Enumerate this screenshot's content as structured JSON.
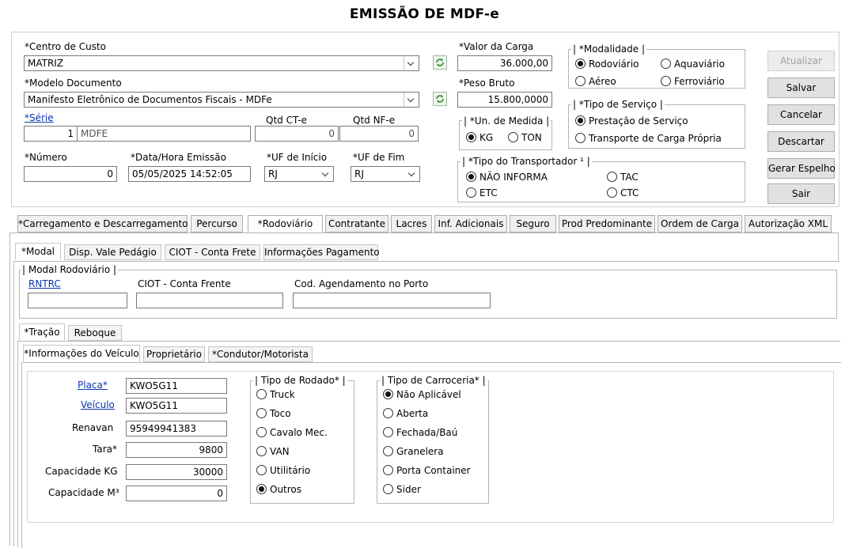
{
  "window_title": "EMISSÃO DE MDF-e",
  "header": {
    "centro_custo_label": "*Centro de Custo",
    "centro_custo_value": "MATRIZ",
    "modelo_label": "*Modelo Documento",
    "modelo_value": "Manifesto Eletrônico de Documentos Fiscais - MDFe",
    "serie_label": "*Série",
    "serie_num": "1",
    "serie_desc": "MDFE",
    "qtd_cte_label": "Qtd CT-e",
    "qtd_cte_value": "0",
    "qtd_nfe_label": "Qtd NF-e",
    "qtd_nfe_value": "0",
    "numero_label": "*Número",
    "numero_value": "0",
    "data_label": "*Data/Hora Emissão",
    "data_value": "05/05/2025 14:52:05",
    "uf_inicio_label": "*UF de Início",
    "uf_inicio_value": "RJ",
    "uf_fim_label": "*UF de Fim",
    "uf_fim_value": "RJ",
    "valor_carga_label": "*Valor da Carga",
    "valor_carga_value": "36.000,00",
    "peso_bruto_label": "*Peso Bruto",
    "peso_bruto_value": "15.800,0000",
    "un_medida_label": "*Un. de Medida",
    "un_kg": "KG",
    "un_ton": "TON",
    "modalidade_label": "*Modalidade",
    "mod_rodoviario": "Rodoviário",
    "mod_aquaviario": "Aquaviário",
    "mod_aereo": "Aéreo",
    "mod_ferroviario": "Ferroviário",
    "tipo_servico_label": "*Tipo de Serviço",
    "serv_prestacao": "Prestação de Serviço",
    "serv_propria": "Transporte de Carga Própria",
    "tipo_transp_label": "*Tipo do Transportador ¹",
    "transp_nao_informa": "NÃO INFORMA",
    "transp_tac": "TAC",
    "transp_etc": "ETC",
    "transp_ctc": "CTC"
  },
  "buttons": {
    "atualizar": "Atualizar",
    "salvar": "Salvar",
    "cancelar": "Cancelar",
    "descartar": "Descartar",
    "gerar_espelho": "Gerar Espelho",
    "sair": "Sair"
  },
  "main_tabs": [
    "*Carregamento e Descarregamento",
    "Percurso",
    "*Rodoviário",
    "Contratante",
    "Lacres",
    "Inf. Adicionais",
    "Seguro",
    "Prod Predominante",
    "Ordem de Carga",
    "Autorização XML"
  ],
  "sub_tabs": [
    "*Modal",
    "Disp. Vale Pedágio",
    "CIOT - Conta Frete",
    "Informações Pagamento"
  ],
  "modal": {
    "group_label": "Modal Rodoviário",
    "rntrc_label": "RNTRC",
    "rntrc_value": "",
    "ciot_label": "CIOT - Conta Frente",
    "ciot_value": "",
    "agend_label": "Cod. Agendamento no Porto",
    "agend_value": ""
  },
  "tracao_tabs": [
    "*Tração",
    "Reboque"
  ],
  "veiculo_tabs": [
    "*Informações do Veículo",
    "Proprietário",
    "*Condutor/Motorista"
  ],
  "veiculo": {
    "placa_label": "Placa*",
    "placa_value": "KWO5G11",
    "veiculo_label": "Veículo",
    "veiculo_value": "KWO5G11",
    "renavan_label": "Renavan",
    "renavan_value": "95949941383",
    "tara_label": "Tara*",
    "tara_value": "9800",
    "cap_kg_label": "Capacidade KG",
    "cap_kg_value": "30000",
    "cap_m3_label": "Capacidade M³",
    "cap_m3_value": "0"
  },
  "rodado": {
    "label": "Tipo de Rodado*",
    "options": [
      "Truck",
      "Toco",
      "Cavalo Mec.",
      "VAN",
      "Utilitário",
      "Outros"
    ],
    "selected_index": 5
  },
  "carroceria": {
    "label": "Tipo de Carroceria*",
    "options": [
      "Não Aplicável",
      "Aberta",
      "Fechada/Baú",
      "Granelera",
      "Porta Container",
      "Sider"
    ],
    "selected_index": 0
  },
  "colors": {
    "link": "#0b35b0",
    "button_bg": "#e1e1e1",
    "border": "#7a7a7a"
  }
}
